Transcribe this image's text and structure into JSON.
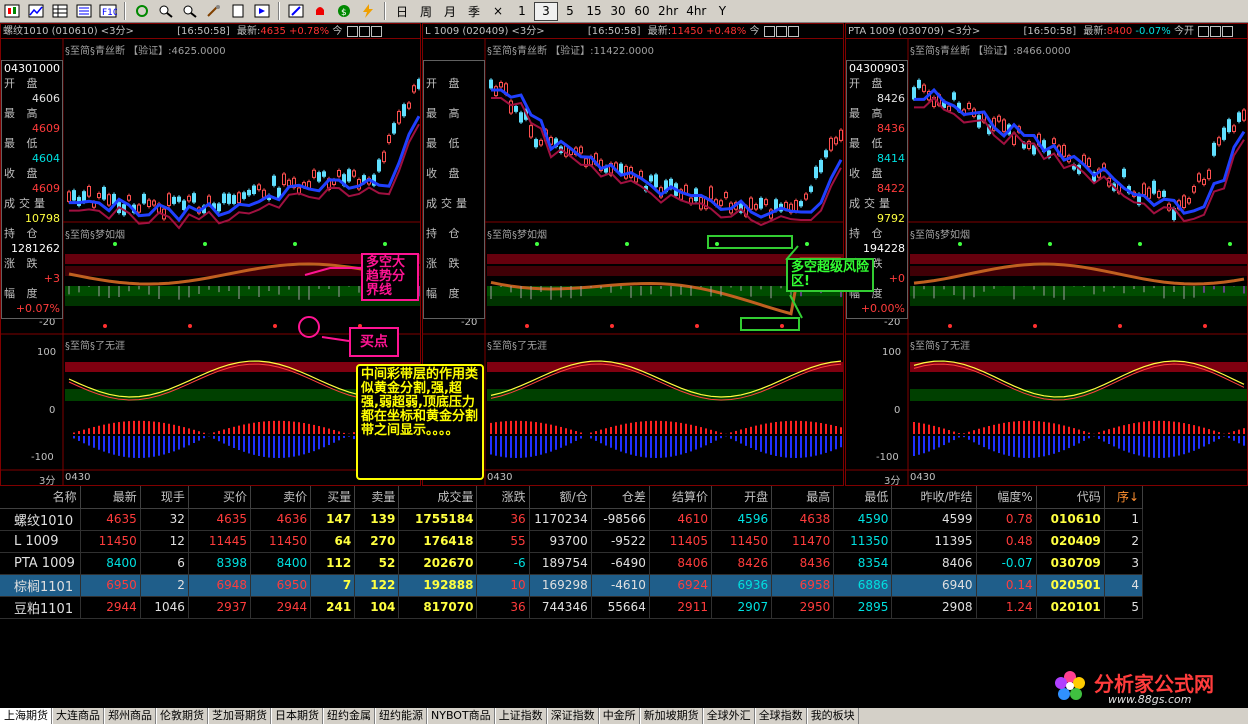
{
  "toolbar": {
    "periods": [
      "日",
      "周",
      "月",
      "季",
      "×",
      "1",
      "3",
      "5",
      "15",
      "30",
      "60",
      "2hr",
      "4hr",
      "Y"
    ],
    "active_period": "3",
    "colors": {
      "bg": "#d4d0c8",
      "up": "#ff3c3c",
      "down": "#00e0e0"
    }
  },
  "panels": [
    {
      "header": "螺纹1010 (010610) <3分>",
      "time": "[16:50:58]",
      "last_label": "最新:",
      "last_value": "4635",
      "pct": "+0.78%",
      "suffix": "今",
      "sub_header": "§至简§青丝断 【验证】:4625.0000",
      "info": {
        "date": "04301000",
        "open_lbl": "开 盘",
        "open": "4606",
        "high_lbl": "最 高",
        "high": "4609",
        "low_lbl": "最 低",
        "low": "4604",
        "close_lbl": "收 盘",
        "close": "4609",
        "vol_lbl": "成交量",
        "vol": "10798",
        "oi_lbl": "持 仓",
        "oi": "1281262",
        "chg_lbl": "涨 跌",
        "chg": "+3",
        "pctl_lbl": "幅 度",
        "pctv": "+0.07%"
      },
      "ind1": "§至简§梦如烟",
      "ind2": "§至简§了无涯",
      "ax_m20": "-20",
      "ax_100": "100",
      "ax_0": "0",
      "ax_m100": "-100",
      "bottom": "3分",
      "bottom_date": "0430"
    },
    {
      "header": "L 1009 (020409) <3分>",
      "time": "[16:50:58]",
      "last_label": "最新:",
      "last_value": "11450",
      "pct": "+0.48%",
      "suffix": "今",
      "sub_header": "§至简§青丝断 【验证】:11422.0000",
      "info": {
        "date": "",
        "open_lbl": "开 盘",
        "open": "",
        "high_lbl": "最 高",
        "high": "",
        "low_lbl": "最 低",
        "low": "",
        "close_lbl": "收 盘",
        "close": "",
        "vol_lbl": "成交量",
        "vol": "",
        "oi_lbl": "持 仓",
        "oi": "",
        "chg_lbl": "涨 跌",
        "chg": "",
        "pctl_lbl": "幅 度",
        "pctv": ""
      },
      "ind1": "§至简§梦如烟",
      "ind2": "§至简§了无涯",
      "ax_m20": "-20",
      "ax_100": "",
      "ax_0": "",
      "ax_m100": "",
      "bottom": "",
      "bottom_date": "0430"
    },
    {
      "header": "PTA 1009 (030709) <3分>",
      "time": "[16:50:58]",
      "last_label": "最新:",
      "last_value": "8400",
      "pct": "-0.07%",
      "suffix": "今开",
      "sub_header": "§至简§青丝断 【验证】:8466.0000",
      "info": {
        "date": "04300903",
        "open_lbl": "开 盘",
        "open": "8426",
        "high_lbl": "最 高",
        "high": "8436",
        "low_lbl": "最 低",
        "low": "8414",
        "close_lbl": "收 盘",
        "close": "8422",
        "vol_lbl": "成交量",
        "vol": "9792",
        "oi_lbl": "持 仓",
        "oi": "194228",
        "chg_lbl": "涨 跌",
        "chg": "+0",
        "pctl_lbl": "幅 度",
        "pctv": "+0.00%"
      },
      "ind1": "§至简§梦如烟",
      "ind2": "§至简§了无涯",
      "ax_m20": "-20",
      "ax_100": "100",
      "ax_0": "0",
      "ax_m100": "-100",
      "bottom": "3分",
      "bottom_date": "0430"
    }
  ],
  "annotations": {
    "trend_line": "多空大趋势分界线",
    "buy_point": "买点",
    "risk_zone": "多空超级风险区!",
    "middle_band": "中间彩带层的作用类似黄金分割,强,超强,弱超弱,顶底压力都在坐标和黄金分割带之间显示。。。。"
  },
  "table": {
    "headers": [
      "名称",
      "最新",
      "现手",
      "买价",
      "卖价",
      "买量",
      "卖量",
      "成交量",
      "涨跌",
      "额/仓",
      "仓差",
      "结算价",
      "开盘",
      "最高",
      "最低",
      "昨收/昨结",
      "幅度%",
      "代码",
      "序↓"
    ],
    "rows": [
      [
        "螺纹1010",
        "4635",
        "32",
        "4635",
        "4636",
        "147",
        "139",
        "1755184",
        "36",
        "1170234",
        "-98566",
        "4610",
        "4596",
        "4638",
        "4590",
        "4599",
        "0.78",
        "010610",
        "1"
      ],
      [
        "L   1009",
        "11450",
        "12",
        "11445",
        "11450",
        "64",
        "270",
        "176418",
        "55",
        "93700",
        "-9522",
        "11405",
        "11450",
        "11470",
        "11350",
        "11395",
        "0.48",
        "020409",
        "2"
      ],
      [
        "PTA  1009",
        "8400",
        "6",
        "8398",
        "8400",
        "112",
        "52",
        "202670",
        "-6",
        "189754",
        "-6490",
        "8406",
        "8426",
        "8436",
        "8354",
        "8406",
        "-0.07",
        "030709",
        "3"
      ],
      [
        "棕榈1101",
        "6950",
        "2",
        "6948",
        "6950",
        "7",
        "122",
        "192888",
        "10",
        "169298",
        "-4610",
        "6924",
        "6936",
        "6958",
        "6886",
        "6940",
        "0.14",
        "020501",
        "4"
      ],
      [
        "豆粕1101",
        "2944",
        "1046",
        "2937",
        "2944",
        "241",
        "104",
        "817070",
        "36",
        "744346",
        "55664",
        "2911",
        "2907",
        "2950",
        "2895",
        "2908",
        "1.24",
        "020101",
        "5"
      ]
    ],
    "selected_row": 3
  },
  "tabs": [
    "上海期货",
    "大连商品",
    "郑州商品",
    "伦敦期货",
    "芝加哥期货",
    "日本期货",
    "纽约金属",
    "纽约能源",
    "NYBOT商品",
    "上证指数",
    "深证指数",
    "中金所",
    "新加坡期货",
    "全球外汇",
    "全球指数",
    "我的板块"
  ],
  "logo": {
    "text": "分析家公式网",
    "url": "www.88gs.com"
  }
}
